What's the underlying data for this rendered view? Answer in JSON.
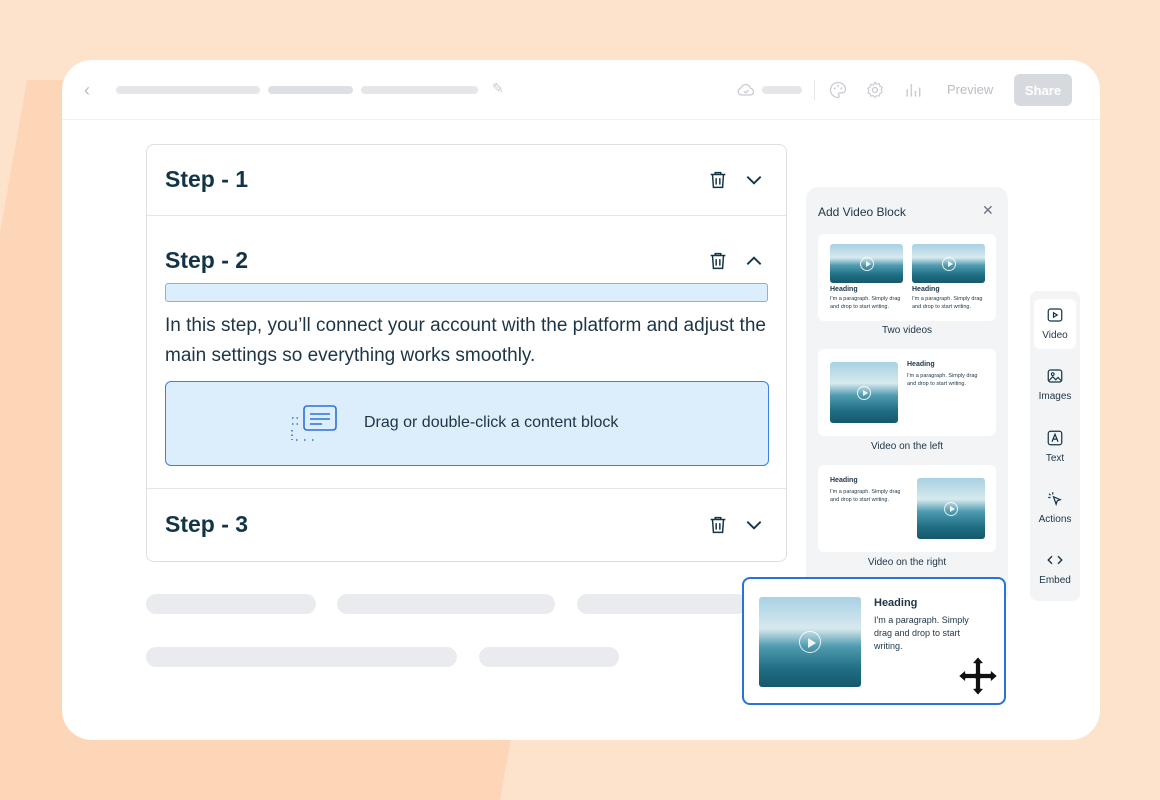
{
  "topbar": {
    "preview_label": "Preview",
    "share_label": "Share"
  },
  "steps": [
    {
      "title": "Step - 1",
      "expanded": false
    },
    {
      "title": "Step - 2",
      "expanded": true,
      "description": "In this step, you’ll connect your account with the platform and adjust the main settings so everything works smoothly.",
      "dropzone_label": "Drag or double-click a content block"
    },
    {
      "title": "Step - 3",
      "expanded": false
    }
  ],
  "video_panel": {
    "title": "Add Video Block",
    "options": [
      {
        "label": "Two videos",
        "heading": "Heading",
        "paragraph": "I'm a paragraph. Simply drag and drop to start writing."
      },
      {
        "label": "Video on the left",
        "heading": "Heading",
        "paragraph": "I'm a paragraph. Simply drag and drop to start writing."
      },
      {
        "label": "Video on the right",
        "heading": "Heading",
        "paragraph": "I'm a paragraph. Simply drag and drop to start writing."
      }
    ]
  },
  "tools": [
    {
      "label": "Video",
      "icon": "video-icon",
      "active": true
    },
    {
      "label": "Images",
      "icon": "image-icon",
      "active": false
    },
    {
      "label": "Text",
      "icon": "text-icon",
      "active": false
    },
    {
      "label": "Actions",
      "icon": "cursor-click-icon",
      "active": false
    },
    {
      "label": "Embed",
      "icon": "code-icon",
      "active": false
    }
  ],
  "drag_card": {
    "heading": "Heading",
    "paragraph": "I'm a paragraph. Simply drag and drop to start writing."
  },
  "colors": {
    "accent": "#2b72d8",
    "text": "#123447",
    "background": "#fde2cc"
  }
}
